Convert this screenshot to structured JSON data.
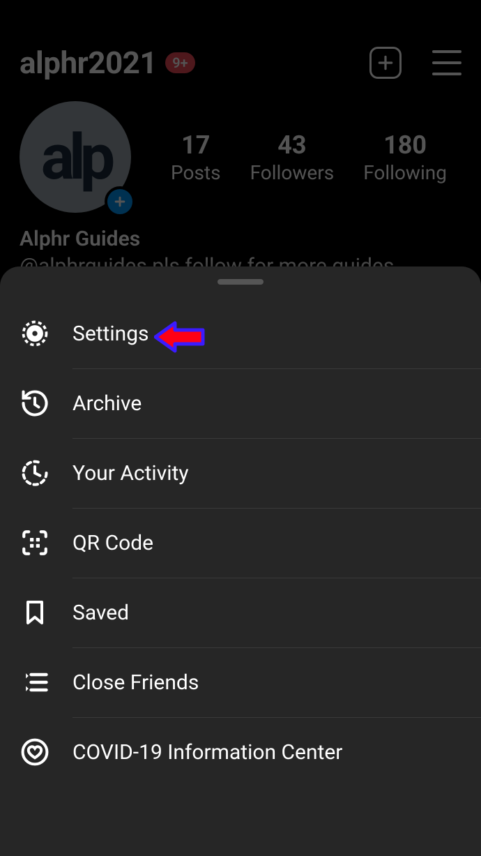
{
  "header": {
    "username": "alphr2021",
    "notification_badge": "9+"
  },
  "profile": {
    "avatar_text": "alp",
    "display_name": "Alphr Guides",
    "bio": "@alphrguides pls follow for more guides"
  },
  "stats": {
    "posts": {
      "count": "17",
      "label": "Posts"
    },
    "followers": {
      "count": "43",
      "label": "Followers"
    },
    "following": {
      "count": "180",
      "label": "Following"
    }
  },
  "menu": {
    "items": [
      {
        "label": "Settings",
        "icon": "gear"
      },
      {
        "label": "Archive",
        "icon": "archive"
      },
      {
        "label": "Your Activity",
        "icon": "activity"
      },
      {
        "label": "QR Code",
        "icon": "qrcode"
      },
      {
        "label": "Saved",
        "icon": "bookmark"
      },
      {
        "label": "Close Friends",
        "icon": "close-friends"
      },
      {
        "label": "COVID-19 Information Center",
        "icon": "covid"
      }
    ]
  }
}
